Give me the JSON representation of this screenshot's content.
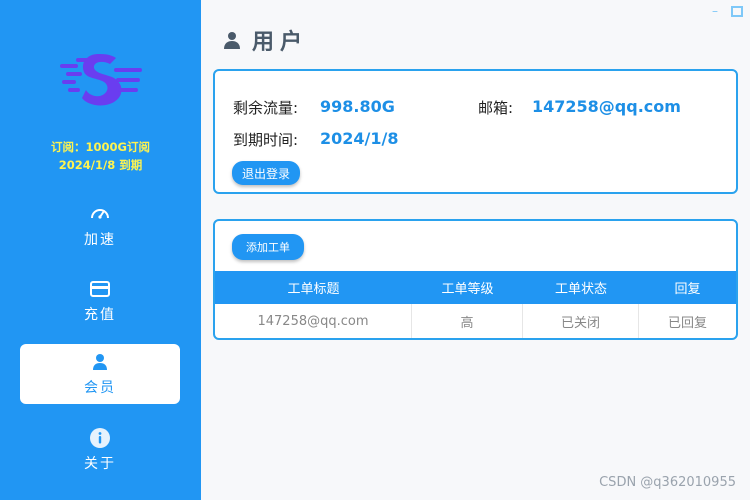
{
  "sidebar": {
    "subscription_line": "订阅：1000G订阅",
    "expiry_line": "2024/1/8 到期",
    "nav": {
      "accelerate": "加速",
      "recharge": "充值",
      "member": "会员",
      "about": "关于"
    },
    "active_item": "会员"
  },
  "window": {
    "minimize_glyph": "–",
    "maximize_glyph": "□"
  },
  "page": {
    "title": "用户"
  },
  "account": {
    "traffic_label": "剩余流量:",
    "traffic_value": "998.80G",
    "email_label": "邮箱:",
    "email_value": "147258@qq.com",
    "expire_label": "到期时间:",
    "expire_value": "2024/1/8",
    "logout_label": "退出登录"
  },
  "tickets": {
    "add_label": "添加工单",
    "columns": [
      "工单标题",
      "工单等级",
      "工单状态",
      "回复"
    ],
    "rows": [
      [
        "147258@qq.com",
        "高",
        "已关闭",
        "已回复"
      ]
    ]
  },
  "watermark": "CSDN @q362010955",
  "colors": {
    "accent": "#2196f3",
    "value_text": "#1d8fe6",
    "subscription_text": "#fff44f"
  },
  "icons": {
    "logo": "s-logo-icon",
    "accelerate": "speedometer-icon",
    "recharge": "credit-card-icon",
    "member": "user-icon",
    "about": "info-icon",
    "title": "user-icon"
  }
}
